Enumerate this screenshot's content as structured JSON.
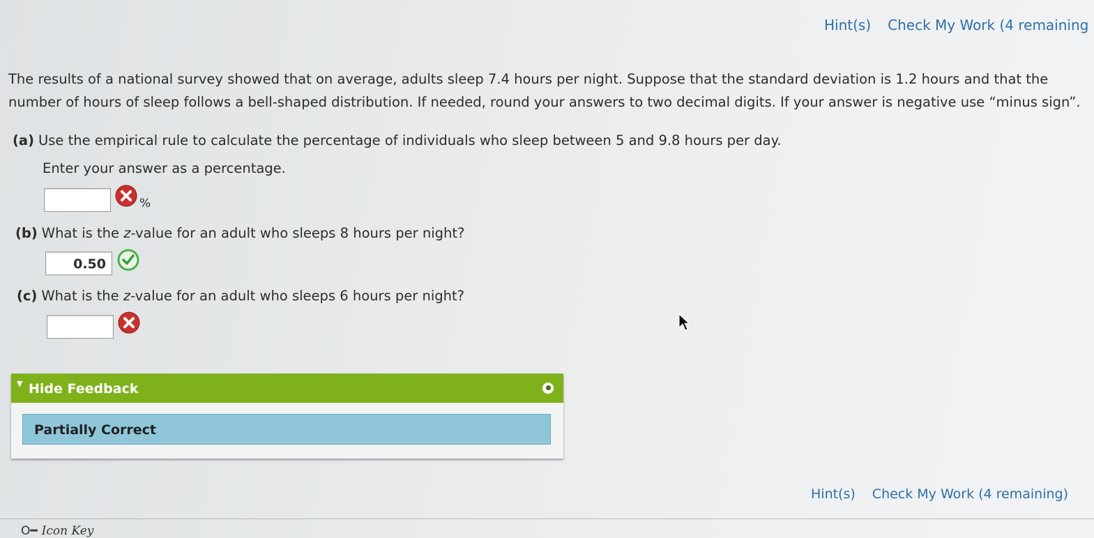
{
  "top_links": {
    "hints": "Hint(s)",
    "check": "Check My Work (4 remaining"
  },
  "intro": "The results of a national survey showed that on average, adults sleep 7.4 hours per night. Suppose that the standard deviation is 1.2 hours and that the number of hours of sleep follows a bell-shaped distribution. If needed, round your answers to two decimal digits. If your answer is negative use “minus sign”.",
  "questions": {
    "a": {
      "label": "(a)",
      "text": "Use the empirical rule to calculate the percentage of individuals who sleep between 5 and 9.8 hours per day.",
      "instruction": "Enter your answer as a percentage.",
      "value": "",
      "unit": "%",
      "status": "incorrect"
    },
    "b": {
      "label": "(b)",
      "text_before": "What is the ",
      "var": "z",
      "text_after": "-value for an adult who sleeps 8 hours per night?",
      "value": "0.50",
      "status": "correct"
    },
    "c": {
      "label": "(c)",
      "text_before": "What is the ",
      "var": "z",
      "text_after": "-value for an adult who sleeps 6 hours per night?",
      "value": "",
      "status": "incorrect"
    }
  },
  "feedback": {
    "toggle_label": "Hide Feedback",
    "result": "Partially Correct"
  },
  "bottom_links": {
    "hints": "Hint(s)",
    "check": "Check My Work (4 remaining)"
  },
  "icon_key": {
    "label": "Icon Key",
    "icon": "key-icon"
  },
  "colors": {
    "link": "#2f6fa8",
    "feedback_bar": "#7fb21a",
    "result_bg": "#8fc7d9",
    "error": "#c9302c",
    "correct": "#4caf50"
  }
}
